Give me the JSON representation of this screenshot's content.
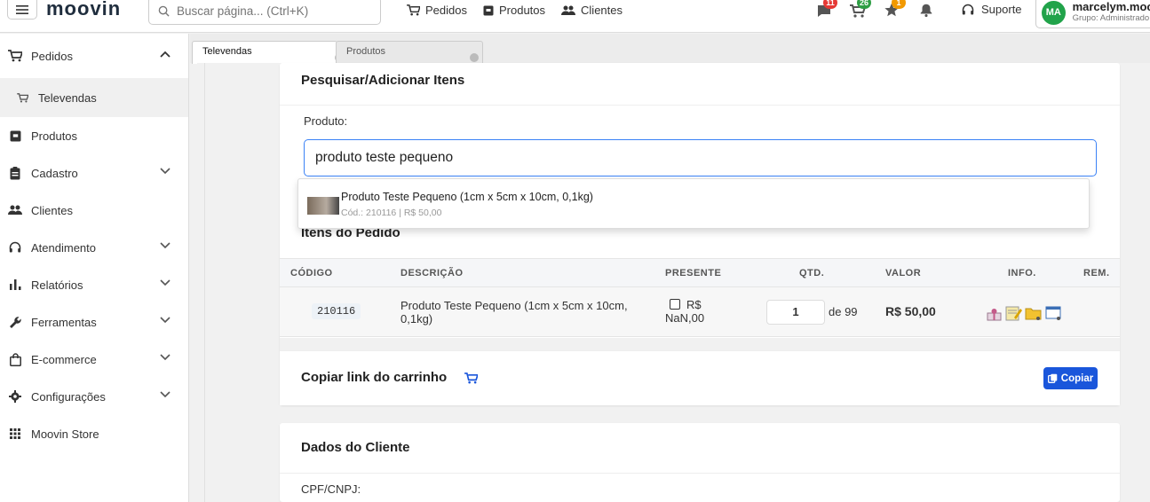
{
  "header": {
    "logo": "moovin",
    "search_placeholder": "Buscar página... (Ctrl+K)",
    "nav": [
      {
        "label": "Pedidos",
        "icon": "cart-icon"
      },
      {
        "label": "Produtos",
        "icon": "box-icon"
      },
      {
        "label": "Clientes",
        "icon": "people-icon"
      }
    ],
    "badges": {
      "messages": "11",
      "cart": "26",
      "star": "1"
    },
    "support_label": "Suporte",
    "user": {
      "initials": "MA",
      "name": "marcelym.moov",
      "group": "Grupo: Administrado"
    },
    "colors": {
      "badge_red": "#e53935",
      "badge_green": "#2e9e44",
      "badge_orange": "#f29900",
      "avatar": "#21a34a"
    }
  },
  "sidebar": {
    "items": [
      {
        "label": "Pedidos",
        "icon": "cart-icon",
        "expanded": true
      },
      {
        "label": "Televendas",
        "icon": "cart-icon",
        "sub": true
      },
      {
        "label": "Produtos",
        "icon": "box-icon"
      },
      {
        "label": "Cadastro",
        "icon": "clipboard-icon"
      },
      {
        "label": "Clientes",
        "icon": "people-icon"
      },
      {
        "label": "Atendimento",
        "icon": "headset-icon"
      },
      {
        "label": "Relatórios",
        "icon": "bar-chart-icon"
      },
      {
        "label": "Ferramentas",
        "icon": "wrench-icon"
      },
      {
        "label": "E-commerce",
        "icon": "bag-icon"
      },
      {
        "label": "Configurações",
        "icon": "gear-icon"
      },
      {
        "label": "Moovin Store",
        "icon": "grid-icon"
      }
    ]
  },
  "tabs": [
    {
      "label": "Televendas",
      "active": true
    },
    {
      "label": "Produtos",
      "active": false
    }
  ],
  "search_items": {
    "title": "Pesquisar/Adicionar Itens",
    "product_label": "Produto:",
    "product_value": "produto teste pequeno"
  },
  "dropdown": {
    "title": "Produto Teste Pequeno (1cm x 5cm x 10cm, 0,1kg)",
    "sub": "Cód.: 210116 | R$ 50,00"
  },
  "order_items": {
    "title": "Itens do Pedido",
    "columns": [
      "CÓDIGO",
      "DESCRIÇÃO",
      "PRESENTE",
      "QTD.",
      "VALOR",
      "INFO.",
      "REM."
    ],
    "rows": [
      {
        "code": "210116",
        "description": "Produto Teste Pequeno (1cm x 5cm x 10cm, 0,1kg)",
        "gift": "R$ NaN,00",
        "gift_line1": "R$",
        "gift_line2": "NaN,00",
        "qty": "1",
        "qty_of": "de 99",
        "value": "R$ 50,00"
      }
    ]
  },
  "cart_link": {
    "title": "Copiar link do carrinho",
    "button": "Copiar",
    "accent": "#1a56db"
  },
  "client": {
    "title": "Dados do Cliente",
    "cpf_label": "CPF/CNPJ:"
  }
}
